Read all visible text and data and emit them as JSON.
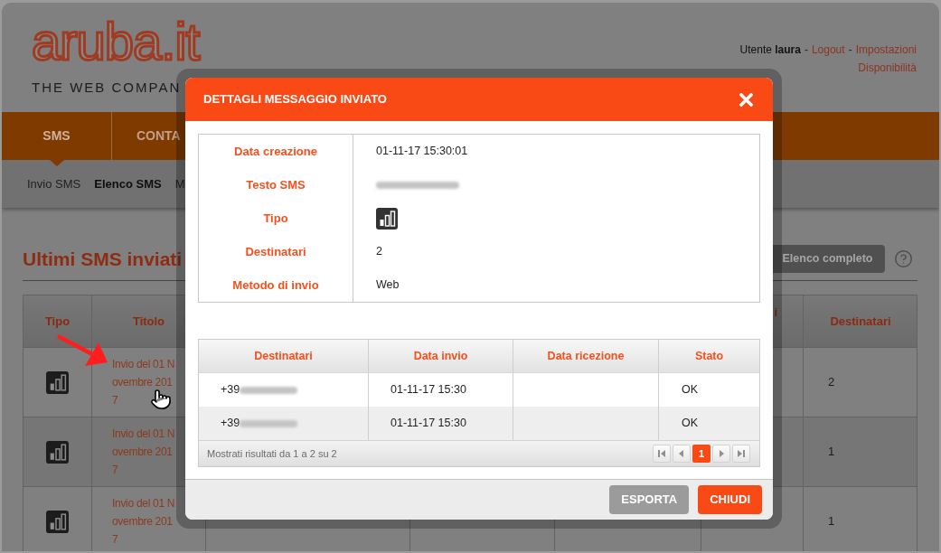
{
  "header": {
    "logo": "aruba.it",
    "tagline": "THE WEB COMPAN",
    "user_bar": [
      {
        "kind": "text",
        "text": "Utente **laura**"
      },
      {
        "kind": "separator",
        "text": "-"
      },
      {
        "kind": "link",
        "text": "Logout"
      },
      {
        "kind": "separator",
        "text": "-"
      },
      {
        "kind": "link",
        "text": "Impostazioni"
      }
    ],
    "availability_link": "Disponibilità"
  },
  "nav": {
    "tabs": [
      {
        "label": "SMS",
        "selected": true
      },
      {
        "label": "CONTA",
        "selected": false
      }
    ]
  },
  "subnav": {
    "items": [
      {
        "label": "Invio SMS",
        "selected": false
      },
      {
        "label": "Elenco SMS",
        "selected": true
      },
      {
        "label": "M",
        "selected": false
      }
    ]
  },
  "section": {
    "title": "Ultimi SMS inviati",
    "button": "Elenco completo"
  },
  "table": {
    "columns": {
      "tipo": "Tipo",
      "titolo": "Titolo",
      "column_6": "i",
      "destinatari": "Destinatari"
    },
    "rows": [
      {
        "title": "Invio del 01 Novembre 2017",
        "recipients": "2"
      },
      {
        "title": "Invio del 01 Novembre 2017",
        "recipients": "1"
      },
      {
        "title": "Invio del 01 Novembre 2017",
        "recipients": "1"
      }
    ]
  },
  "dialog": {
    "title": "DETTAGLI MESSAGGIO INVIATO",
    "details": [
      {
        "label": "Data creazione",
        "kind": "text",
        "value": "01-11-17 15:30:01"
      },
      {
        "label": "Testo SMS",
        "kind": "redacted"
      },
      {
        "label": "Tipo",
        "kind": "icon"
      },
      {
        "label": "Destinatari",
        "kind": "text",
        "value": "2"
      },
      {
        "label": "Metodo di invio",
        "kind": "text",
        "value": "Web"
      }
    ],
    "recipients": {
      "columns": [
        "Destinatari",
        "Data invio",
        "Data ricezione",
        "Stato"
      ],
      "rows": [
        {
          "number": "+39",
          "date_sent": "01-11-17 15:30",
          "status": "OK"
        },
        {
          "number": "+39",
          "date_sent": "01-11-17 15:30",
          "status": "OK"
        }
      ],
      "summary": "Mostrati risultati da 1 a 2 su 2",
      "pages": [
        {
          "label": "1",
          "selected": true
        }
      ]
    },
    "buttons": [
      {
        "label": "ESPORTA",
        "kind": "secondary"
      },
      {
        "label": "CHIUDI",
        "kind": "primary"
      }
    ]
  }
}
